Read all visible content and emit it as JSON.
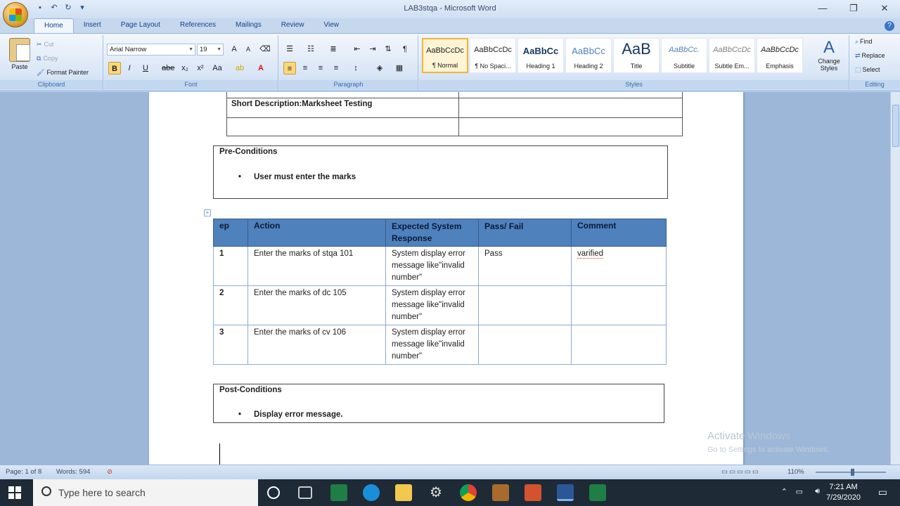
{
  "window": {
    "title": "LAB3stqa - Microsoft Word"
  },
  "ribbon": {
    "tabs": [
      "Home",
      "Insert",
      "Page Layout",
      "References",
      "Mailings",
      "Review",
      "View"
    ],
    "active_tab": "Home",
    "clipboard": {
      "paste": "Paste",
      "cut": "Cut",
      "copy": "Copy",
      "format_painter": "Format Painter",
      "label": "Clipboard"
    },
    "font": {
      "name": "Arial Narrow",
      "size": "19",
      "label": "Font"
    },
    "paragraph": {
      "label": "Paragraph"
    },
    "styles": {
      "items": [
        {
          "sample": "AaBbCcDc",
          "name": "¶ Normal"
        },
        {
          "sample": "AaBbCcDc",
          "name": "¶ No Spaci..."
        },
        {
          "sample": "AaBbCc",
          "name": "Heading 1"
        },
        {
          "sample": "AaBbCc",
          "name": "Heading 2"
        },
        {
          "sample": "AaB",
          "name": "Title"
        },
        {
          "sample": "AaBbCc.",
          "name": "Subtitle"
        },
        {
          "sample": "AaBbCcDc",
          "name": "Subtle Em..."
        },
        {
          "sample": "AaBbCcDc",
          "name": "Emphasis"
        }
      ],
      "change_styles": "Change Styles",
      "label": "Styles"
    },
    "editing": {
      "find": "Find",
      "replace": "Replace",
      "select": "Select",
      "label": "Editing"
    }
  },
  "document": {
    "short_description": "Short Description:Marksheet  Testing",
    "preconditions": {
      "title": "Pre-Conditions",
      "item": "User must enter the marks"
    },
    "table": {
      "headers": [
        "ep",
        "Action",
        "Expected System Response",
        "Pass/ Fail",
        "Comment"
      ],
      "rows": [
        {
          "num": "1",
          "action": "Enter the  marks of stqa 101",
          "expected": "System display error message like\"invalid number\"",
          "pass": "Pass",
          "comment": "varified"
        },
        {
          "num": "2",
          "action": "Enter the  marks of dc 105",
          "expected": "System display error message like\"invalid number\"",
          "pass": "",
          "comment": ""
        },
        {
          "num": "3",
          "action": "Enter the  marks of cv 106",
          "expected": "System display error message like\"invalid number\"",
          "pass": "",
          "comment": ""
        }
      ]
    },
    "postconditions": {
      "title": "Post-Conditions",
      "item": "Display error message."
    },
    "watermark": "Activate Windows",
    "watermark_sub": "Go to Settings to activate Windows."
  },
  "status": {
    "page": "Page: 1 of 8",
    "words": "Words: 594",
    "zoom": "110%"
  },
  "taskbar": {
    "search_placeholder": "Type here to search",
    "time": "7:21 AM",
    "date": "7/29/2020"
  }
}
